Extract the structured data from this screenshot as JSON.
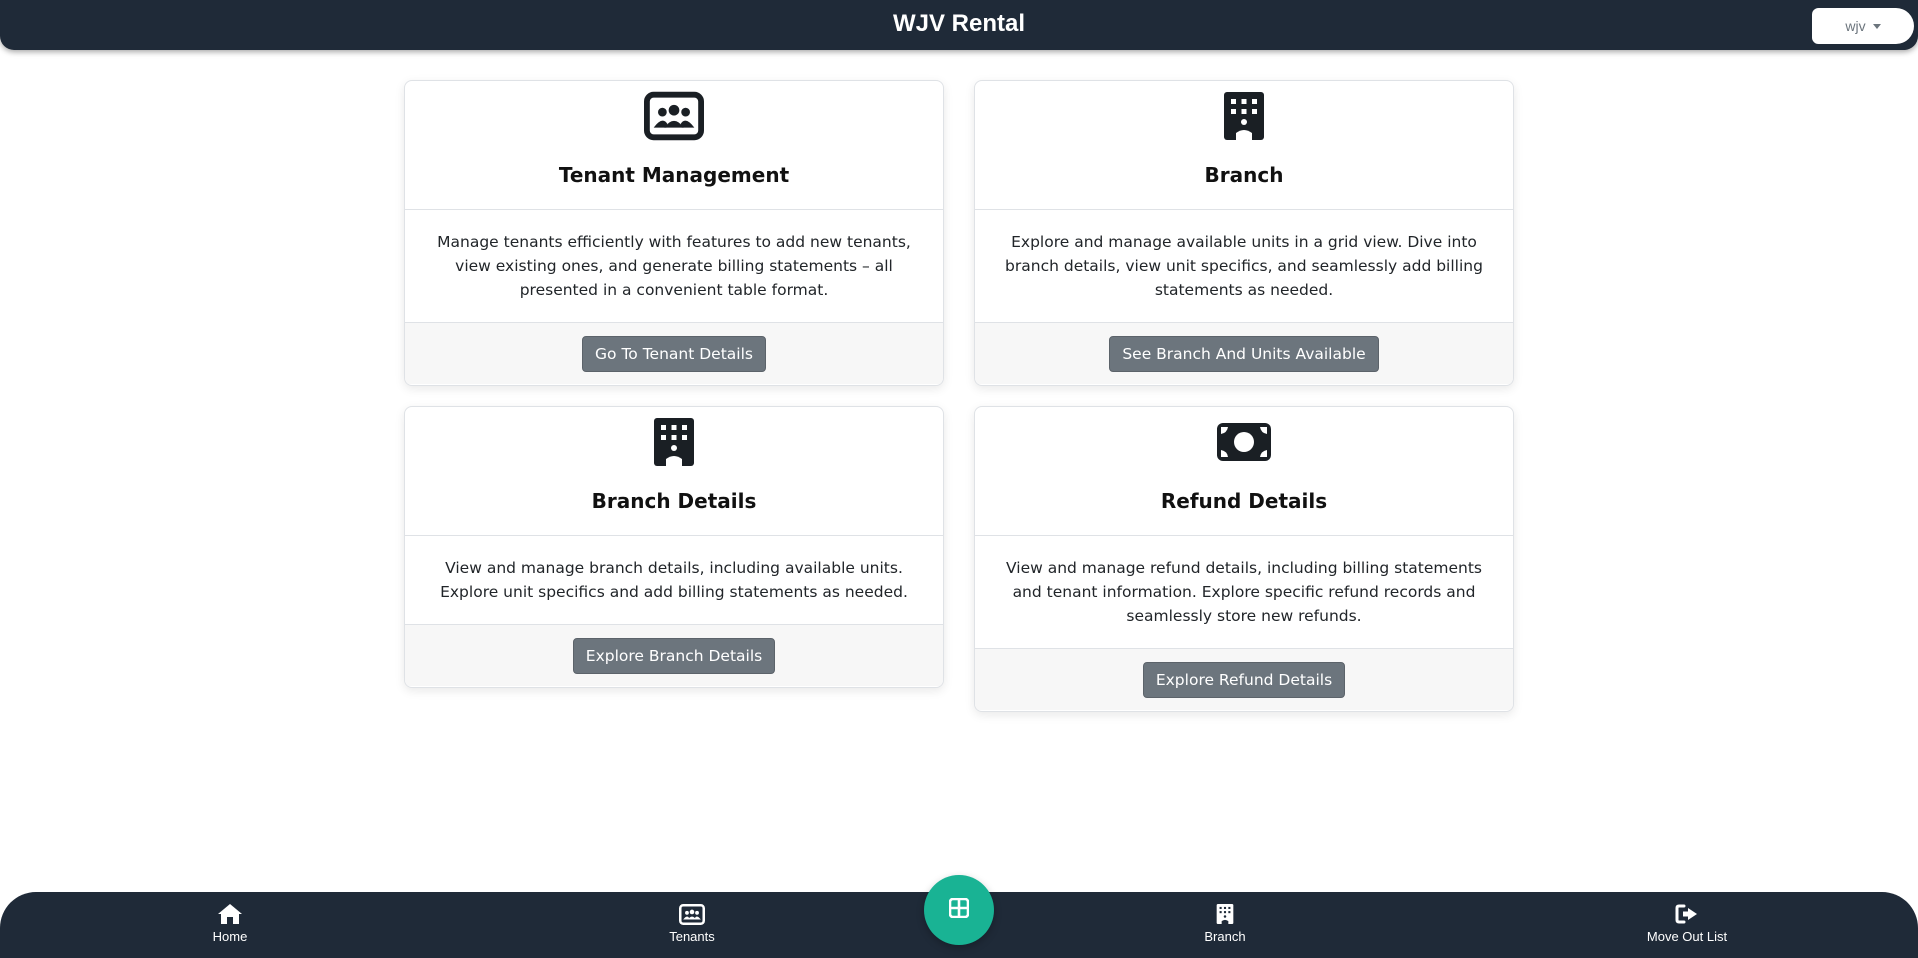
{
  "app": {
    "title": "WJV Rental",
    "user_menu_label": "wjv"
  },
  "colors": {
    "navbar": "#1f2a38",
    "accent": "#19b394",
    "button": "#6c757d"
  },
  "cards": [
    {
      "title": "Tenant Management",
      "icon": "people-card-icon",
      "description": "Manage tenants efficiently with features to add new tenants, view existing ones, and generate billing statements – all presented in a convenient table format.",
      "button_label": "Go To Tenant Details"
    },
    {
      "title": "Branch",
      "icon": "building-icon",
      "description": "Explore and manage available units in a grid view. Dive into branch details, view unit specifics, and seamlessly add billing statements as needed.",
      "button_label": "See Branch And Units Available"
    },
    {
      "title": "Branch Details",
      "icon": "building-icon",
      "description": "View and manage branch details, including available units. Explore unit specifics and add billing statements as needed.",
      "button_label": "Explore Branch Details"
    },
    {
      "title": "Refund Details",
      "icon": "money-bill-icon",
      "description": "View and manage refund details, including billing statements and tenant information. Explore specific refund records and seamlessly store new refunds.",
      "button_label": "Explore Refund Details"
    }
  ],
  "bottom_nav": {
    "items": [
      {
        "label": "Home",
        "icon": "home-icon"
      },
      {
        "label": "Tenants",
        "icon": "people-card-icon"
      },
      {
        "label": "Branch",
        "icon": "building-icon"
      },
      {
        "label": "Move Out List",
        "icon": "sign-out-icon"
      }
    ],
    "center_button_icon": "grid-icon"
  }
}
